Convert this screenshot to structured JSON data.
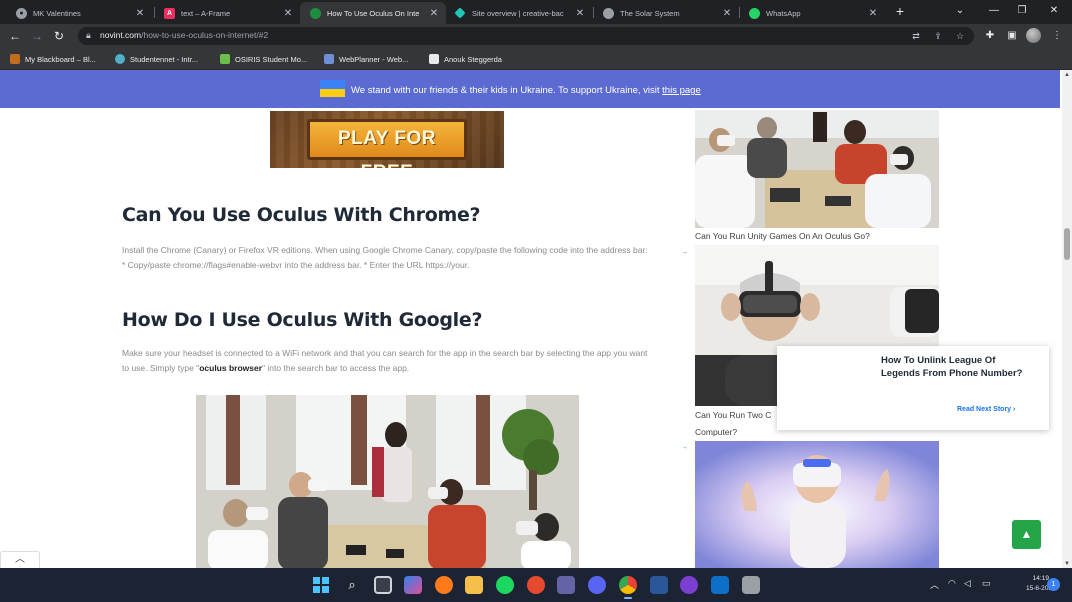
{
  "browser": {
    "tabs": [
      {
        "title": "MK Valentines",
        "favicon": "globe-icon",
        "active": false
      },
      {
        "title": "text – A-Frame",
        "favicon": "aframe-icon",
        "active": false
      },
      {
        "title": "How To Use Oculus On Inte",
        "favicon": "novint-icon",
        "active": true
      },
      {
        "title": "Site overview | creative-bac",
        "favicon": "netlify-icon",
        "active": false
      },
      {
        "title": "The Solar System",
        "favicon": "globe-icon",
        "active": false
      },
      {
        "title": "WhatsApp",
        "favicon": "whatsapp-icon",
        "active": false
      }
    ],
    "new_tab": "+",
    "address": {
      "domain": "novint.com",
      "path": "/how-to-use-oculus-on-internet/#2"
    },
    "bookmarks": [
      {
        "label": "My Blackboard – Bl...",
        "favicon": "blackboard-icon"
      },
      {
        "label": "Studentennet - Intr...",
        "favicon": "studentennet-icon"
      },
      {
        "label": "OSIRIS Student Mo...",
        "favicon": "osiris-icon"
      },
      {
        "label": "WebPlanner - Web...",
        "favicon": "webplanner-icon"
      },
      {
        "label": "Anouk Steggerda",
        "favicon": "page-icon"
      }
    ]
  },
  "banner": {
    "text_before": "We stand with our friends & their kids in Ukraine. To support Ukraine, visit ",
    "link": "this page"
  },
  "ad": {
    "label": "PLAY FOR FREE"
  },
  "article": {
    "section1": {
      "heading": "Can You Use Oculus With Chrome?",
      "body": "Install the Chrome (Canary) or Firefox VR editions. When using Google Chrome Canary, copy/paste the following code into the address bar: * Copy/paste chrome://flags#enable-webvr into the address bar. * Enter the URL https://your."
    },
    "section2": {
      "heading": "How Do I Use Oculus With Google?",
      "body_before": "Make sure your headset is connected to a WiFi network and that you can search for the app in the search bar by selecting the app you want to use. Simply type \"",
      "body_bold": "oculus browser",
      "body_after": "\" into the search bar to access the app."
    }
  },
  "sidebar": {
    "caption1": "Can You Run Unity Games On An Oculus Go?",
    "caption2_line1": "Can You Run Two C",
    "caption2_line2": "Computer?"
  },
  "next_story": {
    "title": "How To Unlink League Of Legends From Phone Number?",
    "read_next": "Read Next Story ›"
  },
  "taskbar": {
    "time": "14:19",
    "date": "15-6-2022",
    "notifications": "1"
  },
  "colors": {
    "banner": "#5c6bd1",
    "scroll_top_button": "#22a447",
    "link_blue": "#1a73e8"
  }
}
